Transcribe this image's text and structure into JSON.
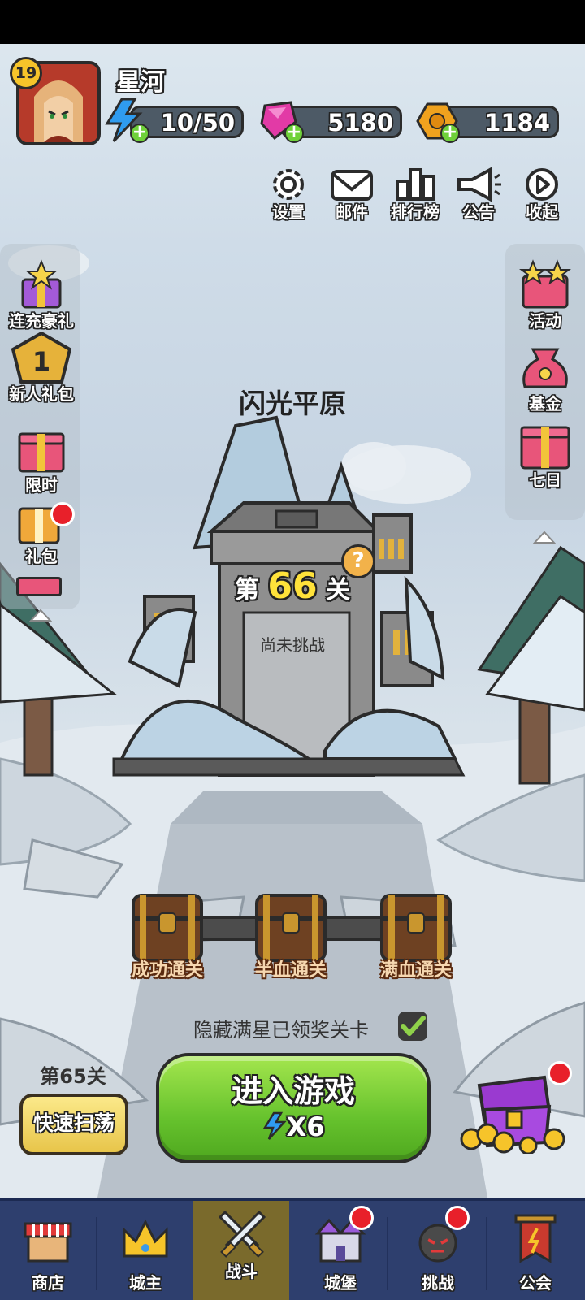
{
  "player": {
    "name": "星河",
    "level": "19",
    "stamina": "10/50",
    "gems": "5180",
    "gold": "1184"
  },
  "top_menu": [
    {
      "label": "设置",
      "icon": "gear-icon"
    },
    {
      "label": "邮件",
      "icon": "mail-icon"
    },
    {
      "label": "排行榜",
      "icon": "leaderboard-icon"
    },
    {
      "label": "公告",
      "icon": "megaphone-icon"
    },
    {
      "label": "收起",
      "icon": "collapse-icon"
    }
  ],
  "left_menu": [
    {
      "label": "连充豪礼",
      "icon": "recharge-gift-icon"
    },
    {
      "label": "新人礼包",
      "icon": "newbie-pack-icon",
      "badge": "1"
    },
    {
      "label": "限时",
      "icon": "limited-gift-icon"
    },
    {
      "label": "礼包",
      "icon": "gift-pack-icon"
    }
  ],
  "right_menu": [
    {
      "label": "活动",
      "icon": "event-icon"
    },
    {
      "label": "基金",
      "icon": "fund-bag-icon"
    },
    {
      "label": "七日",
      "icon": "seven-day-icon"
    }
  ],
  "stage": {
    "area_name": "闪光平原",
    "prefix": "第",
    "number": "66",
    "suffix": "关",
    "status": "尚未挑战",
    "help": "?"
  },
  "chests": [
    "成功通关",
    "半血通关",
    "满血通关"
  ],
  "hide_toggle": {
    "label": "隐藏满星已领奖关卡",
    "checked": true
  },
  "sweep": {
    "stage_label": "第65关",
    "button": "快速扫荡"
  },
  "enter": {
    "title": "进入游戏",
    "cost": "X6"
  },
  "nav": [
    {
      "label": "商店",
      "icon": "shop-icon"
    },
    {
      "label": "城主",
      "icon": "crown-icon"
    },
    {
      "label": "战斗",
      "icon": "swords-icon",
      "active": true
    },
    {
      "label": "城堡",
      "icon": "castle-icon"
    },
    {
      "label": "挑战",
      "icon": "bomb-monster-icon"
    },
    {
      "label": "公会",
      "icon": "guild-banner-icon"
    }
  ],
  "colors": {
    "accent_green": "#66c22d",
    "nav_bg": "#2e3f6e",
    "nav_active": "#7a6a2c",
    "red_dot": "#e8202a"
  }
}
